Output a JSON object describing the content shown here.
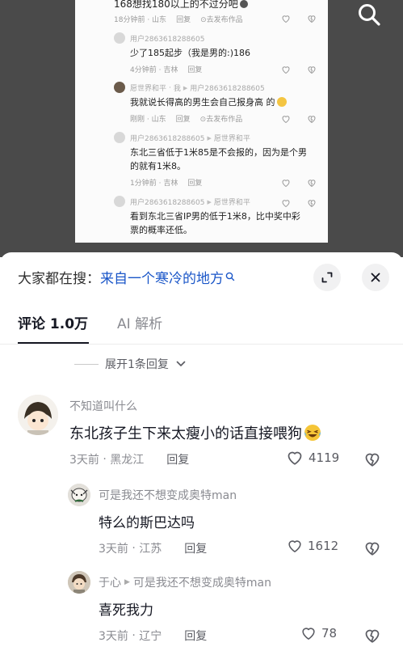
{
  "screenshot": {
    "top_comment_partial": "168想找180以上的不过分吧",
    "top_meta": {
      "time": "18分钟前",
      "location": "山东",
      "reply": "回复",
      "author_tag": "去发布作品"
    },
    "replies": [
      {
        "user": "用户2863618288605",
        "text": "少了185起步（我是男的:)186",
        "time": "4分钟前",
        "location": "吉林",
        "reply": "回复"
      },
      {
        "user": "愿世界和平",
        "tag": "我",
        "reply_to": "用户2863618288605",
        "text": "我就说长得高的男生会自己报身高 的",
        "time": "刚刚",
        "location": "山东",
        "reply": "回复",
        "author_tag": "去发布作品"
      },
      {
        "user": "用户2863618288605",
        "reply_to": "愿世界和平",
        "text_lines": [
          "东北三省低于1米85是不会报的，因为是个男",
          "的就有1米8。"
        ],
        "time": "1分钟前",
        "location": "吉林",
        "reply": "回复"
      },
      {
        "user": "用户2863618288605",
        "reply_to": "愿世界和平",
        "text_lines": [
          "看到东北三省IP男的低于1米8，比中奖中彩",
          "票的概率还低。"
        ]
      }
    ]
  },
  "sheet": {
    "search_prefix": "大家都在搜：",
    "search_term": "来自一个寒冷的地方",
    "tabs": [
      {
        "label": "评论 1.0万",
        "active": true
      },
      {
        "label": "AI 解析",
        "active": false
      }
    ],
    "expand_label": "展开1条回复",
    "comments": [
      {
        "user": "不知道叫什么",
        "text": "东北孩子生下来太瘦小的话直接喂狗",
        "time": "3天前",
        "location": "黑龙江",
        "reply": "回复",
        "likes": "4119"
      },
      {
        "user": "可是我还不想变成奥特man",
        "text": "特么的斯巴达吗",
        "time": "3天前",
        "location": "江苏",
        "reply": "回复",
        "likes": "1612"
      },
      {
        "user": "于心",
        "reply_to": "可是我还不想变成奥特man",
        "text": "喜死我力",
        "time": "3天前",
        "location": "辽宁",
        "reply": "回复",
        "likes": "78"
      }
    ]
  },
  "colors": {
    "link_blue": "#1a56c8",
    "text_dark": "#161823",
    "text_gray": "#8a8b91",
    "overlay": "#4a4a4a"
  }
}
